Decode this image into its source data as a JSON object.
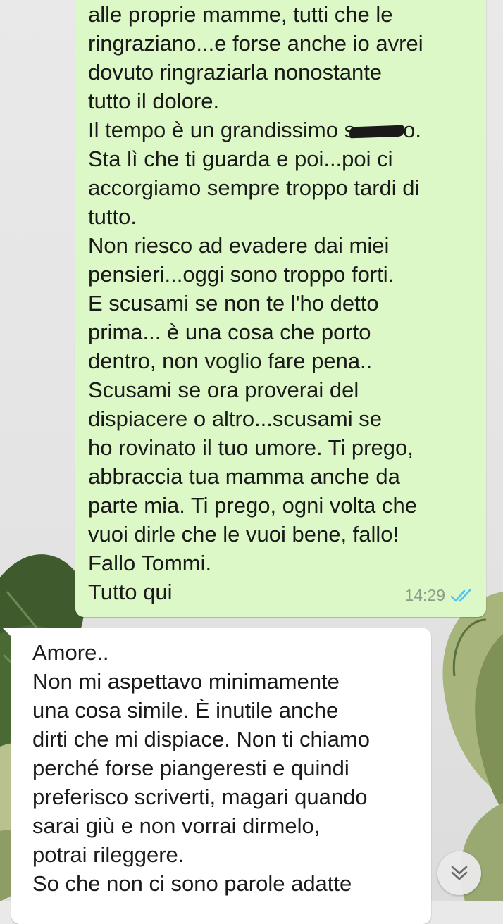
{
  "chat": {
    "messages": [
      {
        "direction": "outgoing",
        "lines": [
          "alle proprie mamme, tutti che le",
          "ringraziano...e forse anche io avrei",
          "dovuto ringraziarla nonostante",
          "tutto il dolore.",
          "Il tempo è un grandissimo s",
          "Sta lì che ti guarda e poi...poi ci",
          "accorgiamo sempre troppo tardi di",
          "tutto.",
          "Non riesco ad evadere dai miei",
          "pensieri...oggi sono troppo forti.",
          "E scusami se non te l'ho detto",
          "prima... è una cosa che porto",
          "dentro, non voglio fare pena..",
          "Scusami se ora proverai del",
          "dispiacere o altro...scusami se",
          "ho rovinato il tuo umore. Ti prego,",
          "abbraccia tua mamma anche da",
          "parte mia. Ti prego, ogni volta che",
          "vuoi dirle che le vuoi bene, fallo!",
          "Fallo Tommi.",
          "Tutto qui"
        ],
        "redacted_tail": "o.",
        "time": "14:29",
        "status_icon": "double-check-read-icon",
        "status_color": "#4fc3f7"
      },
      {
        "direction": "incoming",
        "lines": [
          "Amore..",
          "Non mi aspettavo minimamente",
          "una cosa simile. È inutile anche",
          "dirti che mi dispiace. Non ti chiamo",
          "perché forse piangeresti e quindi",
          "preferisco scriverti, magari quando",
          "sarai giù e non vorrai dirmelo,",
          "potrai rileggere.",
          "So che non ci sono parole adatte"
        ]
      }
    ],
    "scroll_button_icon": "double-chevron-down-icon",
    "colors": {
      "outgoing_bubble": "#dcf8c6",
      "incoming_bubble": "#ffffff",
      "wallpaper": "#e6e6e6",
      "leaf": "#3e5a2c"
    }
  }
}
